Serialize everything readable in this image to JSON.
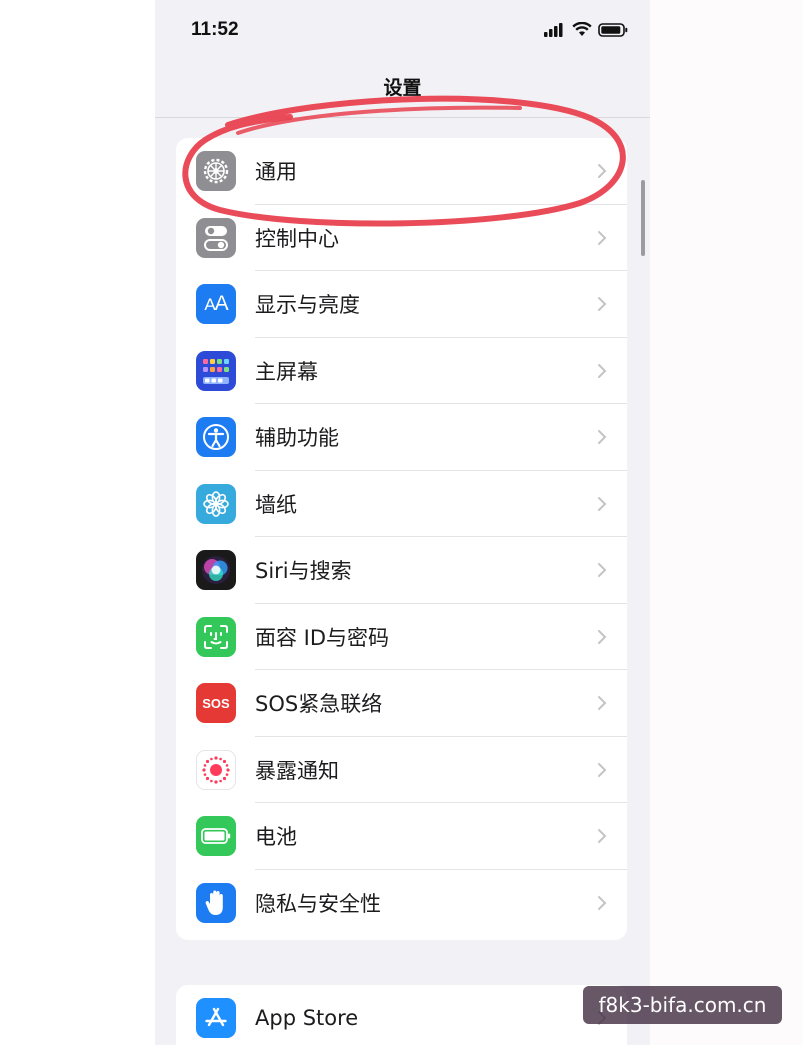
{
  "status_bar": {
    "time": "11:52"
  },
  "nav": {
    "title": "设置"
  },
  "settings": [
    {
      "label": "通用",
      "icon": "gear-icon",
      "color": "#8e8e93"
    },
    {
      "label": "控制中心",
      "icon": "toggles-icon",
      "color": "#8e8e93"
    },
    {
      "label": "显示与亮度",
      "icon": "text-size-icon",
      "color": "#1e7cf2"
    },
    {
      "label": "主屏幕",
      "icon": "app-grid-icon",
      "color": "#2d4bd6"
    },
    {
      "label": "辅助功能",
      "icon": "accessibility-icon",
      "color": "#1e7cf2"
    },
    {
      "label": "墙纸",
      "icon": "flower-icon",
      "color": "#36aadc"
    },
    {
      "label": "Siri与搜索",
      "icon": "siri-icon",
      "color": "#1a1a1a"
    },
    {
      "label": "面容 ID与密码",
      "icon": "face-id-icon",
      "color": "#34c759"
    },
    {
      "label": "SOS紧急联络",
      "icon": "sos-icon",
      "color": "#e53935",
      "icon_text": "SOS"
    },
    {
      "label": "暴露通知",
      "icon": "exposure-icon",
      "color": "#ffffff"
    },
    {
      "label": "电池",
      "icon": "battery-icon",
      "color": "#34c759"
    },
    {
      "label": "隐私与安全性",
      "icon": "hand-icon",
      "color": "#1e7cf2"
    }
  ],
  "store": {
    "label": "App Store",
    "icon": "app-store-icon",
    "color": "#1e90ff"
  },
  "watermark": "f8k3-bifa.com.cn",
  "annotation_color": "#e8424f"
}
